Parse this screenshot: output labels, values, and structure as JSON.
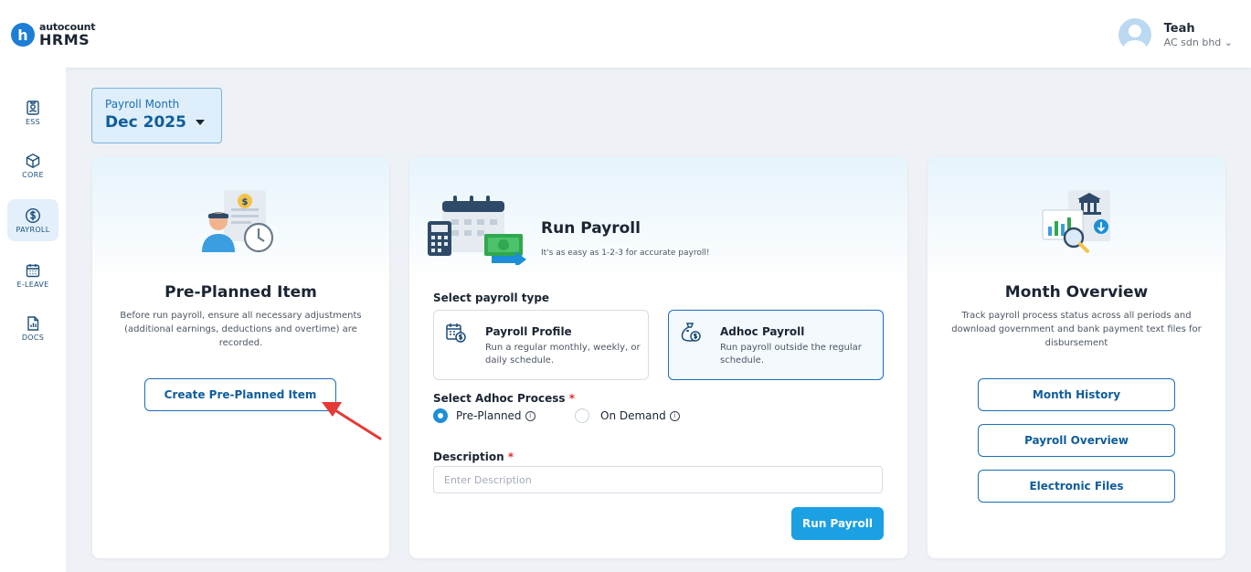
{
  "brand": {
    "logo_letter": "h",
    "company": "autocount",
    "product": "HRMS"
  },
  "user": {
    "name": "Teah",
    "company": "AC sdn bhd",
    "chevron": "⌄"
  },
  "sidebar": {
    "items": [
      {
        "label": "ESS",
        "icon": "id-badge-icon"
      },
      {
        "label": "CORE",
        "icon": "cube-icon"
      },
      {
        "label": "PAYROLL",
        "icon": "dollar-circle-icon"
      },
      {
        "label": "E-LEAVE",
        "icon": "calendar-icon"
      },
      {
        "label": "DOCS",
        "icon": "document-chart-icon"
      }
    ],
    "active": "PAYROLL"
  },
  "payroll_month": {
    "label": "Payroll Month",
    "value": "Dec 2025"
  },
  "pre_planned": {
    "title": "Pre-Planned Item",
    "description": "Before run payroll, ensure all necessary adjustments (additional earnings, deductions and overtime) are recorded.",
    "button": "Create Pre-Planned Item"
  },
  "run_payroll": {
    "title": "Run Payroll",
    "subtitle": "It's as easy as 1-2-3 for accurate payroll!",
    "type_label": "Select payroll type",
    "types": [
      {
        "name": "Payroll Profile",
        "desc": "Run a regular monthly, weekly, or daily schedule.",
        "icon": "calendar-dollar-icon",
        "selected": false
      },
      {
        "name": "Adhoc Payroll",
        "desc": "Run payroll outside the regular schedule.",
        "icon": "money-bag-icon",
        "selected": true
      }
    ],
    "process_label": "Select Adhoc Process",
    "required_mark": "*",
    "process_options": [
      {
        "label": "Pre-Planned",
        "selected": true
      },
      {
        "label": "On Demand",
        "selected": false
      }
    ],
    "info_symbol": "i",
    "description_label": "Description",
    "description_placeholder": "Enter Description",
    "description_value": "",
    "submit": "Run Payroll"
  },
  "month_overview": {
    "title": "Month Overview",
    "description": "Track payroll process status across all periods and download government and bank payment text files for disbursement",
    "buttons": [
      "Month History",
      "Payroll Overview",
      "Electronic Files"
    ]
  },
  "colors": {
    "accent": "#1aa0e3",
    "brand": "#1c7ed6",
    "link": "#0f5d9c",
    "required": "#e03131",
    "annotation": "#e53935"
  }
}
